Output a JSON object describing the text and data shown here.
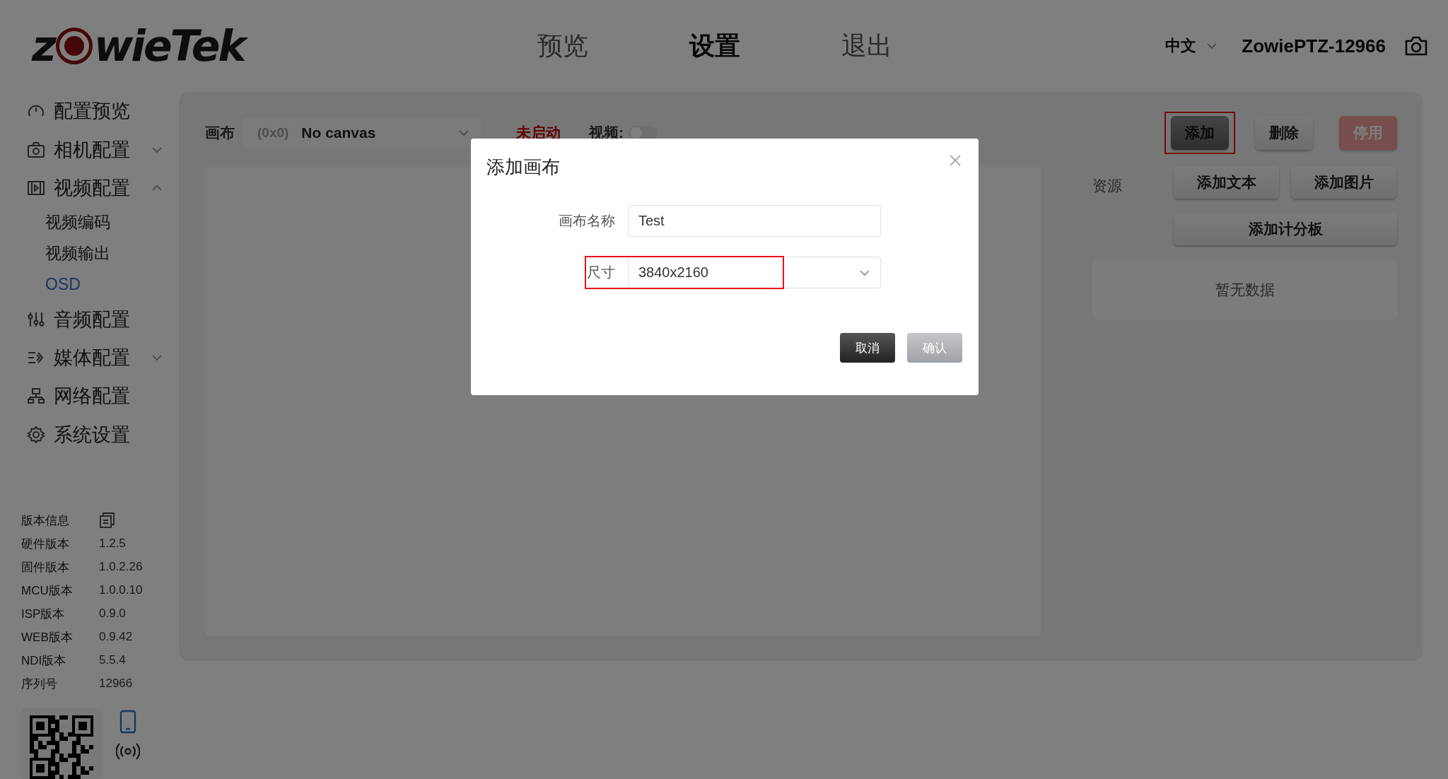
{
  "logo": {
    "before": "z",
    "after": "wieTek"
  },
  "header": {
    "nav": [
      {
        "label": "预览",
        "selected": false
      },
      {
        "label": "设置",
        "selected": true
      },
      {
        "label": "退出",
        "selected": false
      }
    ],
    "language": "中文",
    "device": "ZowiePTZ-12966"
  },
  "sidebar": {
    "items": [
      {
        "label": "配置预览"
      },
      {
        "label": "相机配置",
        "expanded": false
      },
      {
        "label": "视频配置",
        "expanded": true,
        "children": [
          {
            "label": "视频编码",
            "selected": false
          },
          {
            "label": "视频输出",
            "selected": false
          },
          {
            "label": "OSD",
            "selected": true
          }
        ]
      },
      {
        "label": "音频配置"
      },
      {
        "label": "媒体配置",
        "expanded": false
      },
      {
        "label": "网络配置"
      },
      {
        "label": "系统设置"
      }
    ]
  },
  "version_info": {
    "title": "版本信息",
    "rows": [
      {
        "label": "硬件版本",
        "value": "1.2.5"
      },
      {
        "label": "固件版本",
        "value": "1.0.2.26"
      },
      {
        "label": "MCU版本",
        "value": "1.0.0.10"
      },
      {
        "label": "ISP版本",
        "value": "0.9.0"
      },
      {
        "label": "WEB版本",
        "value": "0.9.42"
      },
      {
        "label": "NDI版本",
        "value": "5.5.4"
      },
      {
        "label": "序列号",
        "value": "12966"
      }
    ]
  },
  "toolbar": {
    "canvas_label": "画布",
    "canvas_select": {
      "size": "(0x0)",
      "value": "No canvas"
    },
    "status": "未启动",
    "video_label": "视频:",
    "video_toggle": {
      "on": false
    }
  },
  "actions": [
    {
      "label": "添加",
      "kind": "dark",
      "highlighted": true
    },
    {
      "label": "删除",
      "kind": "light",
      "highlighted": false
    },
    {
      "label": "停用",
      "kind": "danger",
      "highlighted": false
    }
  ],
  "resources": {
    "label": "资源",
    "buttons": [
      {
        "label": "添加文本",
        "wide": false
      },
      {
        "label": "添加图片",
        "wide": false
      },
      {
        "label": "添加计分板",
        "wide": true
      }
    ],
    "empty_text": "暂无数据"
  },
  "dialog": {
    "title": "添加画布",
    "fields": [
      {
        "label": "画布名称",
        "kind": "text",
        "value": "Test",
        "highlighted": false
      },
      {
        "label": "尺寸",
        "kind": "select",
        "value": "3840x2160",
        "highlighted": true
      }
    ],
    "buttons": [
      {
        "label": "取消",
        "kind": "dark"
      },
      {
        "label": "确认",
        "kind": "grey"
      }
    ]
  }
}
